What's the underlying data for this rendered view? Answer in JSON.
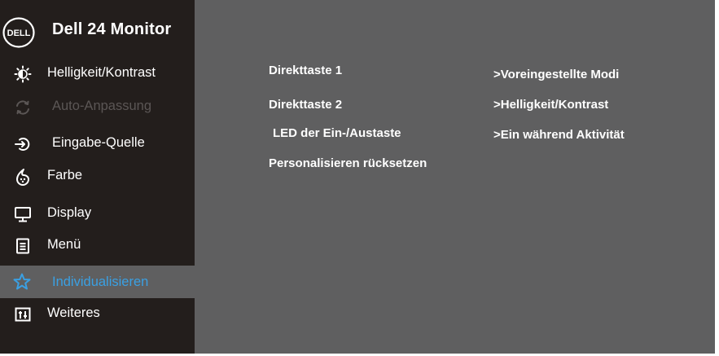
{
  "brand": {
    "logo_text": "DELL",
    "title": "Dell 24 Monitor"
  },
  "colors": {
    "panel": "#5f5f60",
    "sidebar": "#231e1c",
    "accent": "#3aa0e3",
    "disabled": "#5b5655"
  },
  "menu": [
    {
      "label": "Helligkeit/Kontrast",
      "icon": "brightness-icon",
      "state": "normal"
    },
    {
      "label": "Auto-Anpassung",
      "icon": "auto-adjust-icon",
      "state": "disabled"
    },
    {
      "label": "Eingabe-Quelle",
      "icon": "input-source-icon",
      "state": "normal"
    },
    {
      "label": "Farbe",
      "icon": "color-icon",
      "state": "normal"
    },
    {
      "label": "Display",
      "icon": "display-icon",
      "state": "normal"
    },
    {
      "label": "Menü",
      "icon": "menu-icon",
      "state": "normal"
    },
    {
      "label": "Individualisieren",
      "icon": "star-icon",
      "state": "selected"
    },
    {
      "label": "Weiteres",
      "icon": "others-icon",
      "state": "normal"
    }
  ],
  "options": {
    "left": [
      "Direkttaste 1",
      "Direkttaste 2",
      "LED der Ein-/Austaste",
      "Personalisieren rücksetzen"
    ],
    "right": [
      ">Voreingestellte Modi",
      ">Helligkeit/Kontrast",
      ">Ein während Aktivität"
    ]
  }
}
